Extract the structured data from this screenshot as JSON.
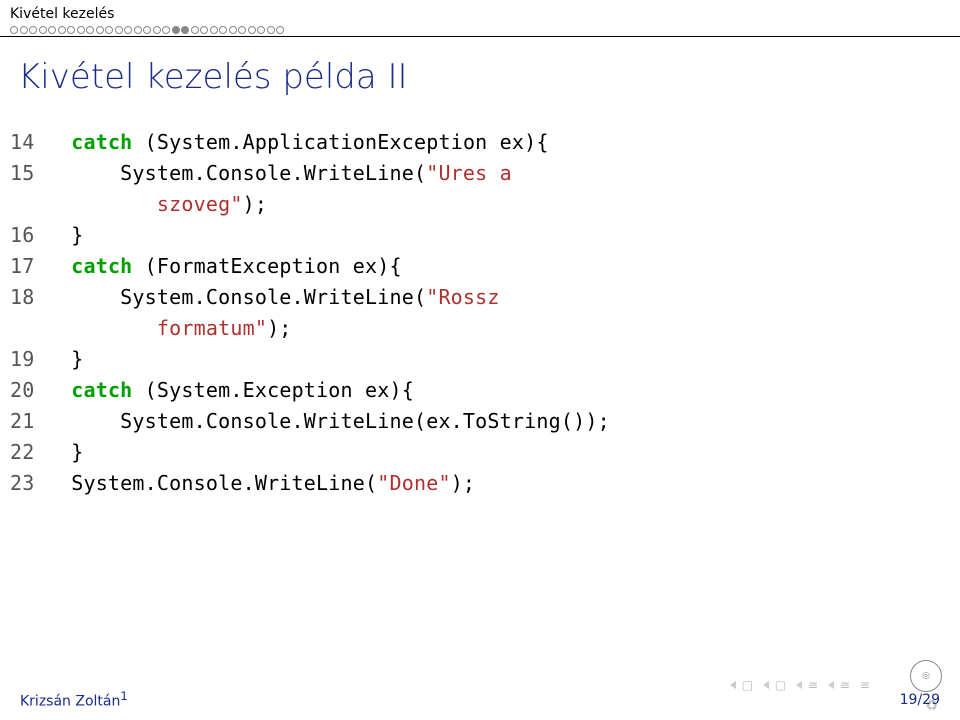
{
  "section": "Kivétel kezelés",
  "progress": {
    "total": 29,
    "current": 19,
    "dots_total": 29,
    "dots_filled": [
      17,
      18
    ]
  },
  "title": "Kivétel kezelés példa II",
  "code_lines": [
    {
      "n": "14",
      "segs": [
        {
          "t": "   ",
          "c": ""
        },
        {
          "t": "catch",
          "c": "kw"
        },
        {
          "t": " (System.ApplicationException ex){",
          "c": ""
        }
      ]
    },
    {
      "n": "15",
      "segs": [
        {
          "t": "       System.Console.WriteLine(",
          "c": ""
        },
        {
          "t": "\"Ures a\n            szoveg\"",
          "c": "str"
        },
        {
          "t": ");",
          "c": ""
        }
      ]
    },
    {
      "n": "16",
      "segs": [
        {
          "t": "   }",
          "c": ""
        }
      ]
    },
    {
      "n": "17",
      "segs": [
        {
          "t": "   ",
          "c": ""
        },
        {
          "t": "catch",
          "c": "kw"
        },
        {
          "t": " (FormatException ex){",
          "c": ""
        }
      ]
    },
    {
      "n": "18",
      "segs": [
        {
          "t": "       System.Console.WriteLine(",
          "c": ""
        },
        {
          "t": "\"Rossz\n            formatum\"",
          "c": "str"
        },
        {
          "t": ");",
          "c": ""
        }
      ]
    },
    {
      "n": "19",
      "segs": [
        {
          "t": "   }",
          "c": ""
        }
      ]
    },
    {
      "n": "20",
      "segs": [
        {
          "t": "   ",
          "c": ""
        },
        {
          "t": "catch",
          "c": "kw"
        },
        {
          "t": " (System.Exception ex){",
          "c": ""
        }
      ]
    },
    {
      "n": "21",
      "segs": [
        {
          "t": "       System.Console.WriteLine(ex.ToString());",
          "c": ""
        }
      ]
    },
    {
      "n": "22",
      "segs": [
        {
          "t": "   }",
          "c": ""
        }
      ]
    },
    {
      "n": "23",
      "segs": [
        {
          "t": "   System.Console.WriteLine(",
          "c": ""
        },
        {
          "t": "\"Done\"",
          "c": "str"
        },
        {
          "t": ");",
          "c": ""
        }
      ]
    }
  ],
  "footer": {
    "author": "Krizsán Zoltán",
    "author_sup": "1",
    "page": "19/29"
  }
}
